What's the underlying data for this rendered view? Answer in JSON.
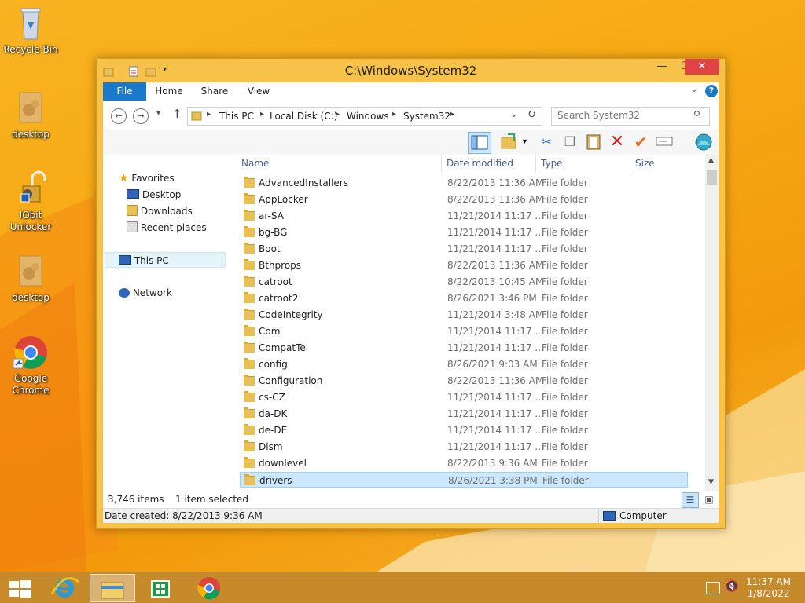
{
  "desktop": {
    "icons": [
      {
        "label": "Recycle Bin"
      },
      {
        "label": "desktop"
      },
      {
        "label": "IObit Unlocker"
      },
      {
        "label": "desktop"
      },
      {
        "label": "Google Chrome"
      }
    ]
  },
  "window": {
    "title": "C:\\Windows\\System32",
    "controls": {
      "minimize": "—",
      "maximize": "☐",
      "close": "✕"
    },
    "ribbon_tabs": [
      "File",
      "Home",
      "Share",
      "View"
    ],
    "help": "?",
    "address": {
      "crumbs": [
        "This PC",
        "Local Disk (C:)",
        "Windows",
        "System32"
      ]
    },
    "search_placeholder": "Search System32",
    "nav_pane": {
      "favorites": "Favorites",
      "favorites_items": [
        "Desktop",
        "Downloads",
        "Recent places"
      ],
      "this_pc": "This PC",
      "network": "Network"
    },
    "columns": [
      "Name",
      "Date modified",
      "Type",
      "Size"
    ],
    "files": [
      {
        "name": "AdvancedInstallers",
        "date": "8/22/2013 11:36 AM",
        "type": "File folder"
      },
      {
        "name": "AppLocker",
        "date": "8/22/2013 11:36 AM",
        "type": "File folder"
      },
      {
        "name": "ar-SA",
        "date": "11/21/2014 11:17 ...",
        "type": "File folder"
      },
      {
        "name": "bg-BG",
        "date": "11/21/2014 11:17 ...",
        "type": "File folder"
      },
      {
        "name": "Boot",
        "date": "11/21/2014 11:17 ...",
        "type": "File folder"
      },
      {
        "name": "Bthprops",
        "date": "8/22/2013 11:36 AM",
        "type": "File folder"
      },
      {
        "name": "catroot",
        "date": "8/22/2013 10:45 AM",
        "type": "File folder"
      },
      {
        "name": "catroot2",
        "date": "8/26/2021 3:46 PM",
        "type": "File folder"
      },
      {
        "name": "CodeIntegrity",
        "date": "11/21/2014 3:48 AM",
        "type": "File folder"
      },
      {
        "name": "Com",
        "date": "11/21/2014 11:17 ...",
        "type": "File folder"
      },
      {
        "name": "CompatTel",
        "date": "11/21/2014 11:17 ...",
        "type": "File folder"
      },
      {
        "name": "config",
        "date": "8/26/2021 9:03 AM",
        "type": "File folder"
      },
      {
        "name": "Configuration",
        "date": "8/22/2013 11:36 AM",
        "type": "File folder"
      },
      {
        "name": "cs-CZ",
        "date": "11/21/2014 11:17 ...",
        "type": "File folder"
      },
      {
        "name": "da-DK",
        "date": "11/21/2014 11:17 ...",
        "type": "File folder"
      },
      {
        "name": "de-DE",
        "date": "11/21/2014 11:17 ...",
        "type": "File folder"
      },
      {
        "name": "Dism",
        "date": "11/21/2014 11:17 ...",
        "type": "File folder"
      },
      {
        "name": "downlevel",
        "date": "8/22/2013 9:36 AM",
        "type": "File folder"
      },
      {
        "name": "drivers",
        "date": "8/26/2021 3:38 PM",
        "type": "File folder",
        "selected": true
      }
    ],
    "status": {
      "count": "3,746 items",
      "selected": "1 item selected"
    },
    "detail": {
      "created": "Date created: 8/22/2013 9:36 AM",
      "location": "Computer"
    }
  },
  "taskbar": {
    "clock_time": "11:37 AM",
    "clock_date": "1/8/2022"
  },
  "colors": {
    "desktop_bg": "#f6a813",
    "window_frame": "#f6c24a",
    "file_tab": "#1979ca",
    "selection": "#cce8ff",
    "close_button": "#e04343"
  }
}
